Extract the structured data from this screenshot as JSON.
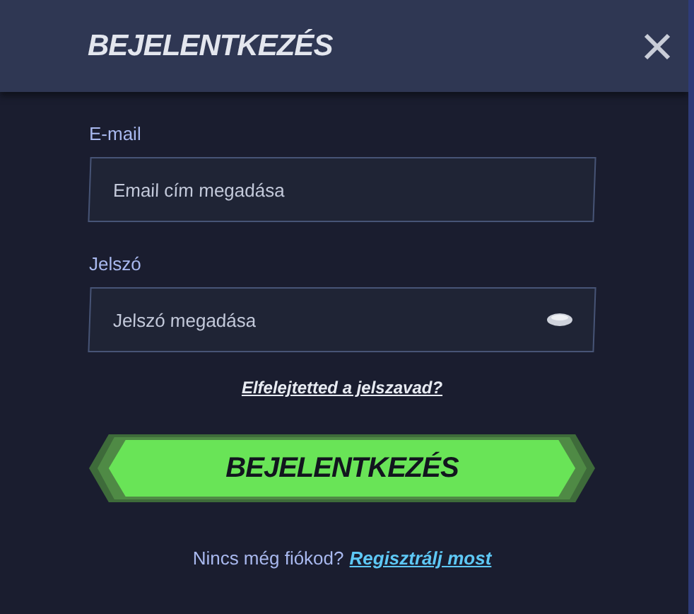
{
  "header": {
    "title": "BEJELENTKEZÉS"
  },
  "fields": [
    {
      "label": "E-mail",
      "placeholder": "Email cím megadása",
      "kind": "text"
    },
    {
      "label": "Jelszó",
      "placeholder": "Jelszó megadása",
      "kind": "password"
    }
  ],
  "forgot_link": "Elfelejtetted a jelszavad?",
  "submit_button": "BEJELENTKEZÉS",
  "footer": {
    "text": "Nincs még fiókod?",
    "link": "Regisztrálj most"
  }
}
